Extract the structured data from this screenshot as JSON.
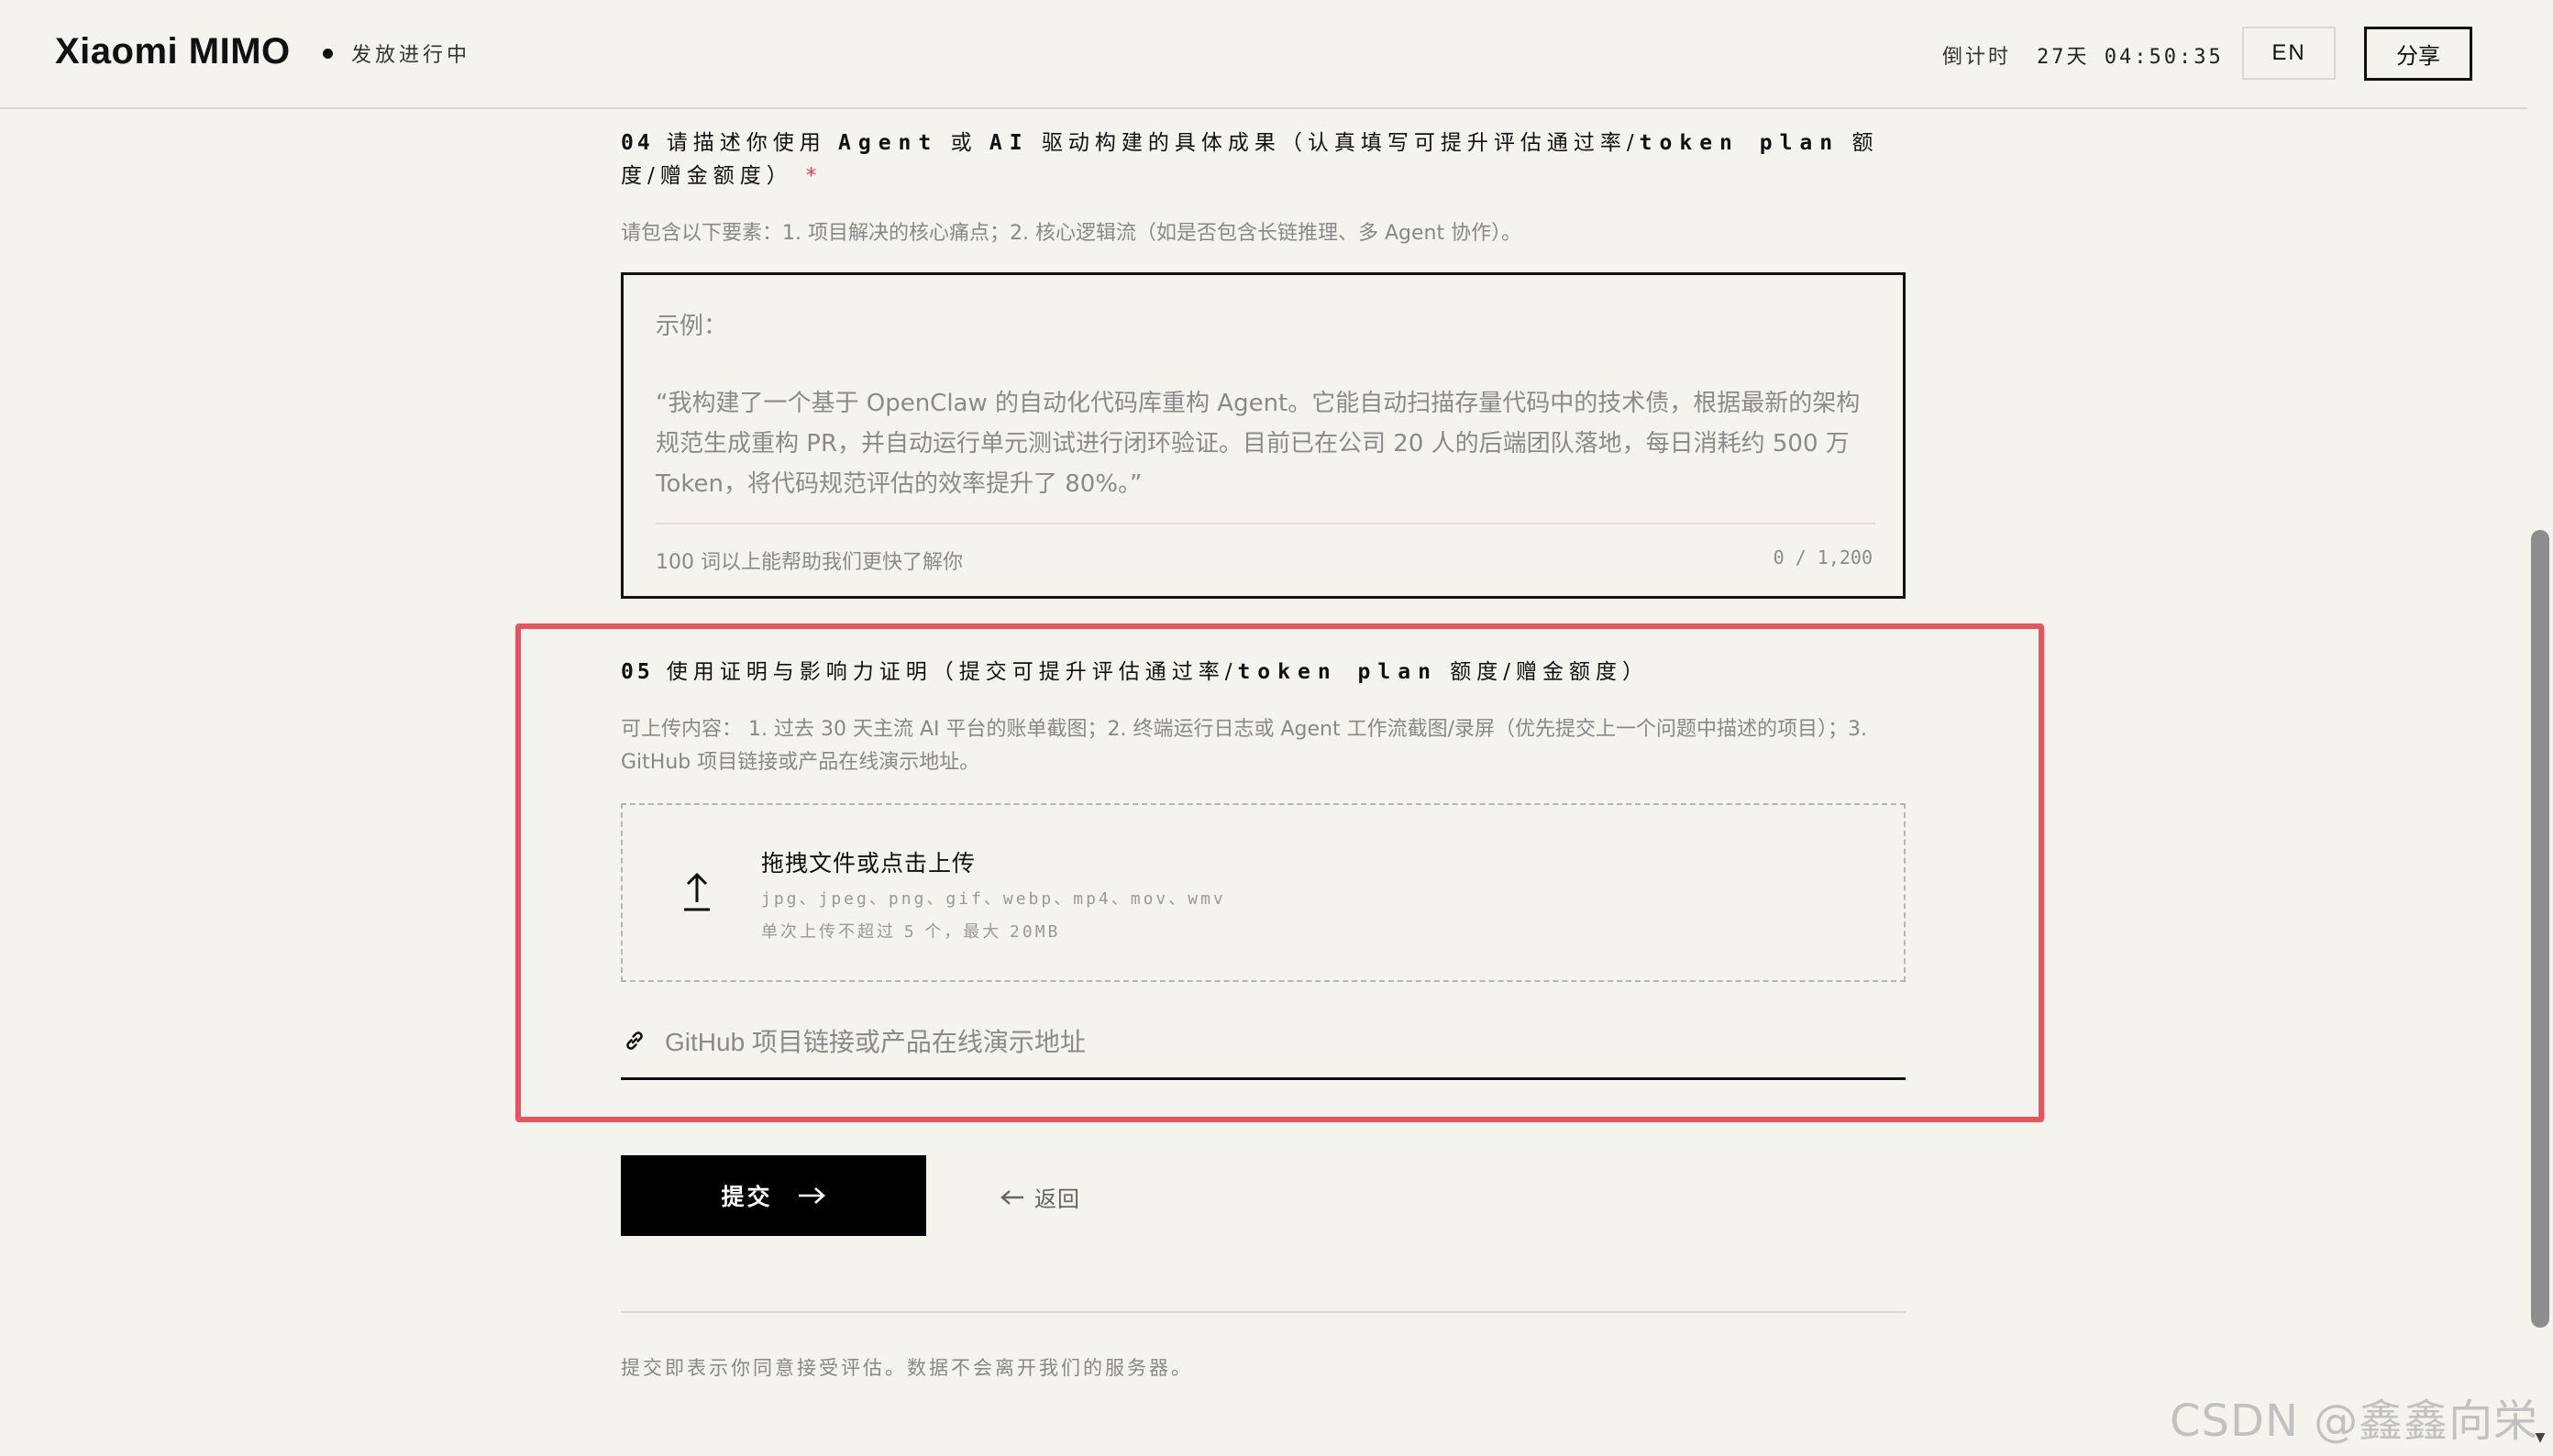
{
  "header": {
    "logo": "Xiaomi MIMO",
    "status": "发放进行中",
    "countdown_label": "倒计时",
    "countdown_value": "27天 04:50:35",
    "lang_button": "EN",
    "share_button": "分享"
  },
  "q4": {
    "number": "04",
    "title_a": "请描述你使用",
    "title_agent": "Agent",
    "title_or": "或",
    "title_ai": "AI",
    "title_b": "驱动构建的具体成果（认真填写可提升评估通过率/",
    "title_token": "token plan",
    "title_c": "额",
    "title_line2": "度/赠金额度）",
    "required_mark": "*",
    "hint": "请包含以下要素：1. 项目解决的核心痛点；2. 核心逻辑流（如是否包含长链推理、多 Agent 协作）。",
    "textarea": {
      "label": "示例：",
      "example_line1": "“我构建了一个基于 OpenClaw 的自动化代码库重构 Agent。它能自动扫描存量代码中的技术债，根据最新的架构",
      "example_line2": "规范生成重构 PR，并自动运行单元测试进行闭环验证。目前已在公司 20 人的后端团队落地，每日消耗约 500 万",
      "example_line3": "Token，将代码规范评估的效率提升了 80%。”",
      "footer_hint": "100 词以上能帮助我们更快了解你",
      "counter": "0 / 1,200"
    }
  },
  "q5": {
    "number": "05",
    "title_a": "使用证明与影响力证明（提交可提升评估通过率/",
    "title_token": "token plan",
    "title_b": "额度/赠金额度）",
    "hint_line1": "可上传内容： 1. 过去 30 天主流 AI 平台的账单截图；2. 终端运行日志或 Agent 工作流截图/录屏（优先提交上一个问题中描述的项目）；3.",
    "hint_line2": "GitHub 项目链接或产品在线演示地址。",
    "upload": {
      "title": "拖拽文件或点击上传",
      "types": "jpg、jpeg、png、gif、webp、mp4、mov、wmv",
      "limit_a": "单次上传不超过",
      "limit_count": "5",
      "limit_b": "个，最大",
      "limit_size": "20MB"
    },
    "link_placeholder": "GitHub 项目链接或产品在线演示地址"
  },
  "actions": {
    "submit": "提交",
    "back": "返回"
  },
  "footer": {
    "note": "提交即表示你同意接受评估。数据不会离开我们的服务器。"
  },
  "watermark": "CSDN @鑫鑫向栄",
  "colors": {
    "background": "#f5f3ee",
    "highlight": "#e8545b",
    "required": "#e0455b",
    "primary": "#000000"
  }
}
